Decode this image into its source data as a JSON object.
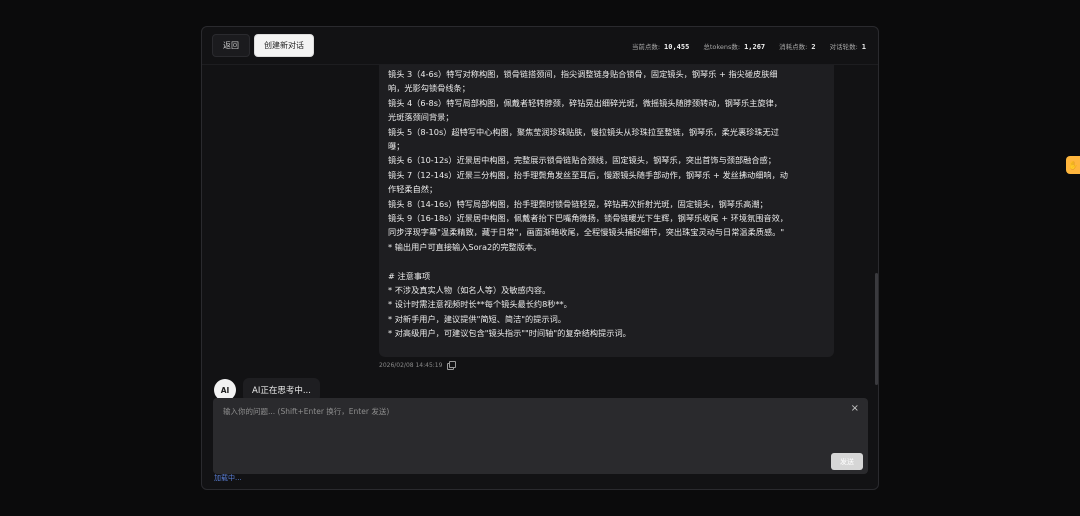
{
  "topbar": {
    "back_label": "返回",
    "new_chat_label": "创建新对话",
    "stats": [
      {
        "label": "当前点数:",
        "value": "10,455"
      },
      {
        "label": "总tokens数:",
        "value": "1,267"
      },
      {
        "label": "消耗点数:",
        "value": "2"
      },
      {
        "label": "对话轮数:",
        "value": "1"
      }
    ]
  },
  "user_message": {
    "lines": [
      "镜头 3（4-6s）特写对称构图，锁骨链搭颈间，指尖调整链身贴合锁骨，固定镜头，钢琴乐 + 指尖碰皮肤细",
      "响，光影勾锁骨线条；",
      "镜头 4（6-8s）特写局部构图，佩戴者轻转脖颈，碎钻晃出细碎光斑，微摇镜头随脖颈转动，钢琴乐主旋律，",
      "光斑落颈间背景；",
      "镜头 5（8-10s）超特写中心构图，聚焦莹润珍珠贴肤，慢拉镜头从珍珠拉至整链，钢琴乐，柔光裹珍珠无过",
      "曝；",
      "镜头 6（10-12s）近景居中构图，完整展示锁骨链贴合颈线，固定镜头，钢琴乐，突出首饰与颈部融合感；",
      "镜头 7（12-14s）近景三分构图，抬手理鬓角发丝至耳后，慢跟镜头随手部动作，钢琴乐 + 发丝拂动细响，动",
      "作轻柔自然；",
      "镜头 8（14-16s）特写局部构图，抬手理鬓时锁骨链轻晃，碎钻再次折射光斑，固定镜头，钢琴乐高潮；",
      "镜头 9（16-18s）近景居中构图，佩戴者抬下巴嘴角微扬，锁骨链暖光下生辉，钢琴乐收尾 + 环境氛围音效，",
      "同步浮现字幕\"温柔精致，藏于日常\"，画面渐暗收尾，全程慢镜头捕捉细节，突出珠宝灵动与日常温柔质感。\"",
      "* 输出用户可直接输入Sora2的完整版本。",
      "",
      "# 注意事项",
      "* 不涉及真实人物（如名人等）及敏感内容。",
      "* 设计时需注意视频时长**每个镜头最长约8秒**。",
      "* 对新手用户，建议提供\"简短、简洁\"的提示词。",
      "* 对高级用户，可建议包含\"镜头指示\"\"时间轴\"的复杂结构提示词。"
    ],
    "timestamp": "2026/02/08 14:45:19"
  },
  "ai_message": {
    "avatar_label": "AI",
    "text": "AI正在思考中..."
  },
  "composer": {
    "placeholder": "输入你的问题... (Shift+Enter 换行，Enter 发送)",
    "value": "",
    "clear_symbol": "×",
    "send_label": "发送"
  },
  "footer": {
    "loading_text": "加载中..."
  },
  "side_widget": {
    "icon": "hand-icon",
    "glyph": "✋"
  }
}
